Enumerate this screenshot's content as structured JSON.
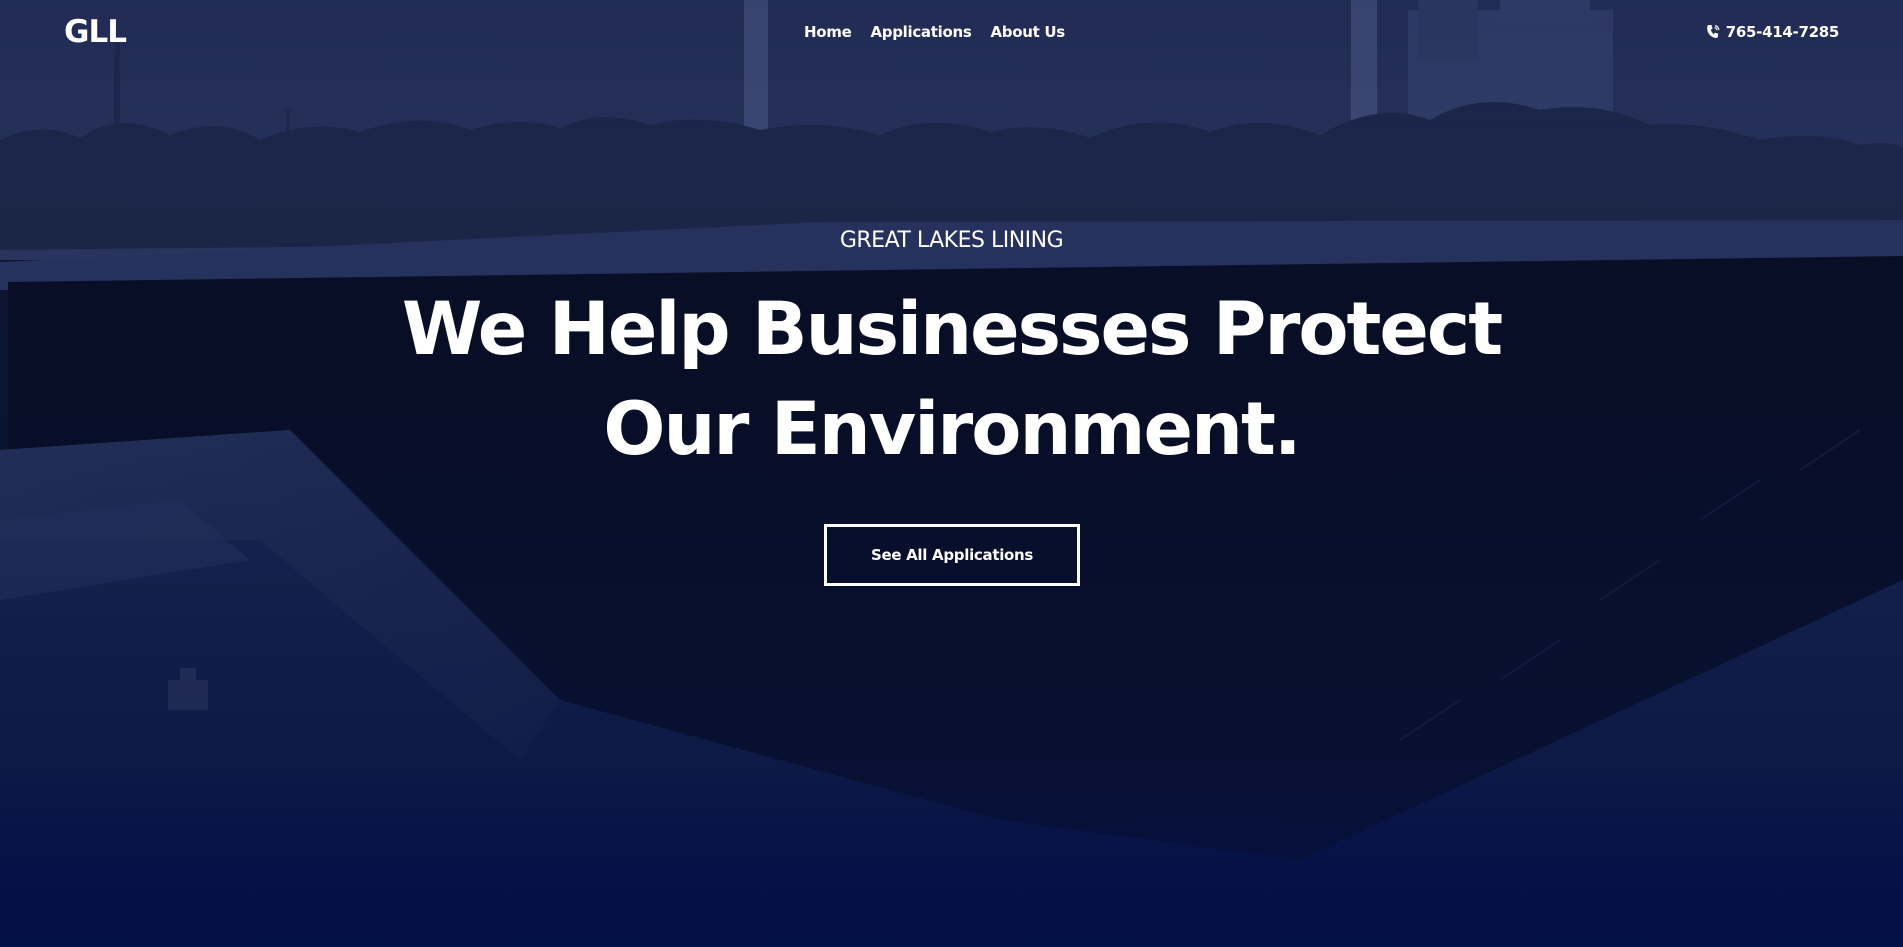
{
  "header": {
    "logo": "GLL",
    "nav": [
      {
        "label": "Home"
      },
      {
        "label": "Applications"
      },
      {
        "label": "About Us"
      }
    ],
    "phone": {
      "icon": "phone-icon",
      "number": "765-414-7285"
    }
  },
  "hero": {
    "eyebrow": "GREAT LAKES LINING",
    "headline": "We Help Businesses Protect Our Environment.",
    "cta_label": "See All Applications",
    "background_description_colors": {
      "sky": "#2a3560",
      "liner": "#050a1c",
      "ground": "#0d1a45",
      "bottom_glow": "#021046"
    }
  },
  "colors": {
    "text": "#ffffff",
    "overlay_navy": "#0b1430"
  }
}
